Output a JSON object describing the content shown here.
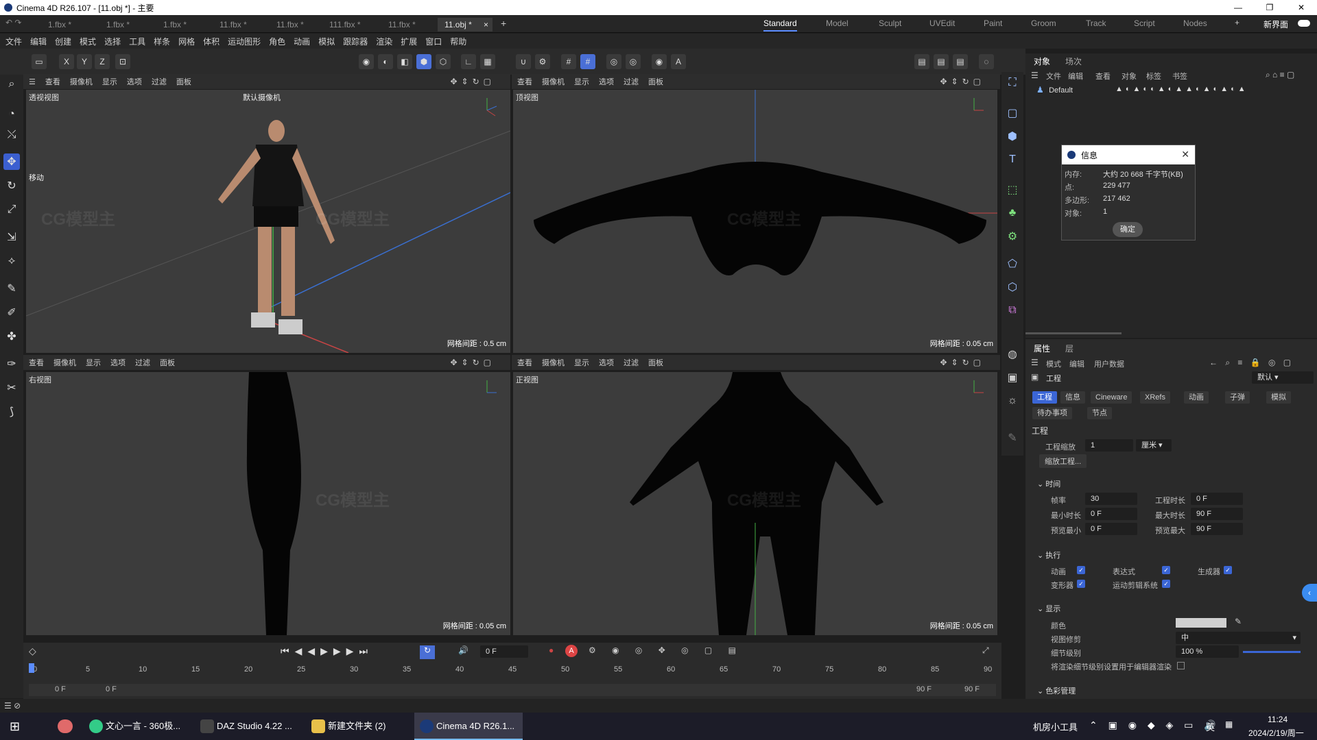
{
  "window": {
    "title": "Cinema 4D R26.107 - [11.obj *] - 主要",
    "controls": [
      "—",
      "❐",
      "✕"
    ]
  },
  "file_tabs": [
    "1.fbx *",
    "1.fbx *",
    "1.fbx *",
    "11.fbx *",
    "11.fbx *",
    "111.fbx *",
    "11.fbx *",
    "11.obj *"
  ],
  "close_tab": "×",
  "add_tab": "+",
  "layouts": [
    "Standard",
    "Model",
    "Sculpt",
    "UVEdit",
    "Paint",
    "Groom",
    "Track",
    "Script",
    "Nodes"
  ],
  "new_interface": "新界面",
  "menu": [
    "文件",
    "编辑",
    "创建",
    "模式",
    "选择",
    "工具",
    "样条",
    "网格",
    "体积",
    "运动图形",
    "角色",
    "动画",
    "模拟",
    "跟踪器",
    "渲染",
    "扩展",
    "窗口",
    "帮助"
  ],
  "axes": {
    "x": "X",
    "y": "Y",
    "z": "Z"
  },
  "viewport_menu": [
    "查看",
    "摄像机",
    "显示",
    "选项",
    "过滤",
    "面板"
  ],
  "viewports": {
    "perspective": {
      "title": "透视视图",
      "camera": "默认摄像机",
      "grid": "网格间距 : 0.5 cm",
      "move_label": "移动"
    },
    "top": {
      "title": "顶视图",
      "grid": "网格间距 : 0.05 cm"
    },
    "right": {
      "title": "右视图",
      "grid": "网格间距 : 0.05 cm"
    },
    "front": {
      "title": "正视图",
      "grid": "网格间距 : 0.05 cm"
    }
  },
  "object_panel": {
    "tabs": [
      "对象",
      "场次"
    ],
    "menu": [
      "文件",
      "编辑",
      "查看",
      "对象",
      "标签",
      "书签"
    ],
    "default_label": "Default"
  },
  "info_dialog": {
    "title": "信息",
    "rows": [
      [
        "内存:",
        "大约 20 668 千字节(KB)"
      ],
      [
        "点:",
        "229 477"
      ],
      [
        "多边形:",
        "217 462"
      ],
      [
        "对象:",
        "1"
      ]
    ],
    "ok": "确定",
    "close": "✕"
  },
  "attr_panel": {
    "tabs": [
      "属性",
      "层"
    ],
    "menu": [
      "模式",
      "编辑",
      "用户数据"
    ],
    "project_label": "工程",
    "preset": "默认",
    "subtabs": [
      "工程",
      "信息",
      "Cineware",
      "XRefs",
      "动画",
      "子弹",
      "模拟"
    ],
    "subtabs2": [
      "待办事项",
      "节点"
    ],
    "section_project": "工程",
    "scale_label": "工程缩放",
    "scale_value": "1",
    "scale_unit": "厘米",
    "scale_btn": "缩放工程...",
    "time_section": "时间",
    "fps_label": "帧率",
    "fps": "30",
    "proj_len_label": "工程时长",
    "proj_len": "0 F",
    "min_label": "最小时长",
    "min": "0 F",
    "max_label": "最大时长",
    "max": "90 F",
    "prev_min_label": "预览最小",
    "prev_min": "0 F",
    "prev_max_label": "预览最大",
    "prev_max": "90 F",
    "exec_section": "执行",
    "exec": [
      "动画",
      "表达式",
      "生成器",
      "变形器",
      "运动剪辑系统"
    ],
    "display_section": "显示",
    "color_label": "颜色",
    "clip_label": "视图修剪",
    "clip_value": "中",
    "lod_label": "细节级别",
    "lod_value": "100 %",
    "lod_note": "将渲染细节级别设置用于编辑器渲染",
    "color_mgmt": "色彩管理"
  },
  "timeline": {
    "ticks": [
      "0",
      "5",
      "10",
      "15",
      "20",
      "25",
      "30",
      "35",
      "40",
      "45",
      "50",
      "55",
      "60",
      "65",
      "70",
      "75",
      "80",
      "85",
      "90"
    ],
    "current_frame": "0 F",
    "start": "0 F",
    "start2": "0 F",
    "end": "90 F",
    "end2": "90 F"
  },
  "taskbar": {
    "items": [
      "文心一言 - 360极...",
      "DAZ Studio 4.22 ...",
      "新建文件夹 (2)",
      "Cinema 4D R26.1..."
    ],
    "tray_label": "机房小工具",
    "lang": "英",
    "time": "11:24",
    "date": "2024/2/19/周一"
  },
  "watermark": "CG模型主"
}
